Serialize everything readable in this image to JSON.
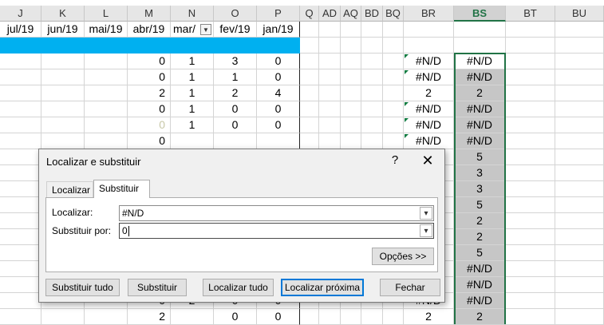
{
  "columns": [
    "J",
    "K",
    "L",
    "M",
    "N",
    "O",
    "P",
    "Q",
    "AD",
    "AQ",
    "BD",
    "BQ",
    "BR",
    "BS",
    "BT",
    "BU"
  ],
  "row1": [
    "jul/19",
    "jun/19",
    "mai/19",
    "abr/19",
    "mar/",
    "fev/19",
    "jan/19"
  ],
  "rows": [
    {
      "M": "0",
      "N": "1",
      "O": "3",
      "P": "0",
      "BR": "#N/D",
      "BS": "#N/D"
    },
    {
      "M": "0",
      "N": "1",
      "O": "1",
      "P": "0",
      "BR": "#N/D",
      "BS": "#N/D"
    },
    {
      "M": "2",
      "N": "1",
      "O": "2",
      "P": "4",
      "BR": "2",
      "BS": "2"
    },
    {
      "M": "0",
      "N": "1",
      "O": "0",
      "P": "0",
      "BR": "#N/D",
      "BS": "#N/D"
    },
    {
      "M": "0",
      "N": "1",
      "O": "0",
      "P": "0",
      "BR": "#N/D",
      "BS": "#N/D"
    },
    {
      "M": "0",
      "N": "",
      "O": "",
      "P": "",
      "BR": "#N/D",
      "BS": "#N/D"
    },
    {
      "M": "",
      "N": "",
      "O": "",
      "P": "",
      "BR": "",
      "BS": "5"
    },
    {
      "M": "",
      "N": "",
      "O": "",
      "P": "",
      "BR": "",
      "BS": "3"
    },
    {
      "M": "",
      "N": "",
      "O": "",
      "P": "",
      "BR": "",
      "BS": "3"
    },
    {
      "M": "",
      "N": "",
      "O": "",
      "P": "",
      "BR": "",
      "BS": "5"
    },
    {
      "M": "",
      "N": "",
      "O": "",
      "P": "",
      "BR": "",
      "BS": "2"
    },
    {
      "M": "",
      "N": "",
      "O": "",
      "P": "",
      "BR": "",
      "BS": "2"
    },
    {
      "M": "",
      "N": "",
      "O": "",
      "P": "",
      "BR": "",
      "BS": "5"
    },
    {
      "M": "",
      "N": "",
      "O": "",
      "P": "",
      "BR": "",
      "BS": "#N/D"
    },
    {
      "M": "",
      "N": "",
      "O": "",
      "P": "",
      "BR": "",
      "BS": "#N/D"
    },
    {
      "M": "0",
      "N": "2",
      "O": "0",
      "P": "0",
      "BR": "#N/D",
      "BS": "#N/D"
    },
    {
      "M": "2",
      "N": "",
      "O": "0",
      "P": "0",
      "BR": "2",
      "BS": "2"
    }
  ],
  "dialog": {
    "title": "Localizar e substituir",
    "help": "?",
    "close": "✕",
    "tabs": [
      "Localizar",
      "Substituir"
    ],
    "find_label": "Localizar:",
    "replace_label": "Substituir por:",
    "find_value": "#N/D",
    "replace_value": "0",
    "options_button": "Opções >>",
    "buttons": [
      "Substituir tudo",
      "Substituir",
      "Localizar tudo",
      "Localizar próxima",
      "Fechar"
    ]
  },
  "colors": {
    "band": "#00b0f0",
    "selection": "#217346",
    "selected_fill": "#c6c6c6"
  }
}
